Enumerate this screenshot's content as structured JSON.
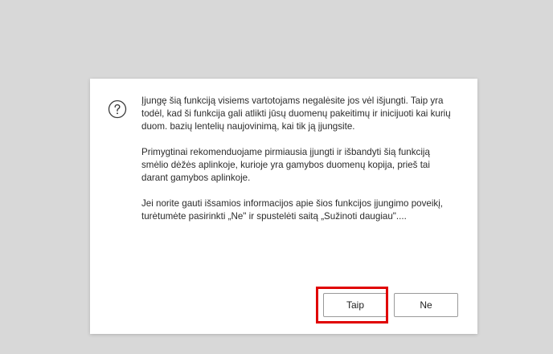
{
  "dialog": {
    "icon": "question-circle-icon",
    "paragraphs": [
      "Įjungę šią funkciją visiems vartotojams negalėsite jos vėl išjungti. Taip yra todėl, kad ši funkcija gali atlikti jūsų duomenų pakeitimų ir inicijuoti kai kurių duom. bazių lentelių naujovinimą, kai tik ją įjungsite.",
      "Primygtinai rekomenduojame pirmiausia įjungti ir išbandyti šią funkciją smėlio dėžės aplinkoje, kurioje yra gamybos duomenų kopija, prieš tai darant gamybos aplinkoje.",
      "Jei norite gauti išsamios informacijos apie šios funkcijos įjungimo poveikį, turėtumėte pasirinkti „Ne\" ir spustelėti saitą „Sužinoti daugiau\"...."
    ],
    "buttons": {
      "yes_label": "Taip",
      "no_label": "Ne"
    }
  },
  "colors": {
    "backdrop": "#d8d8d8",
    "dialog_background": "#ffffff",
    "highlight": "#e00000",
    "icon_stroke": "#3a3a3a"
  }
}
